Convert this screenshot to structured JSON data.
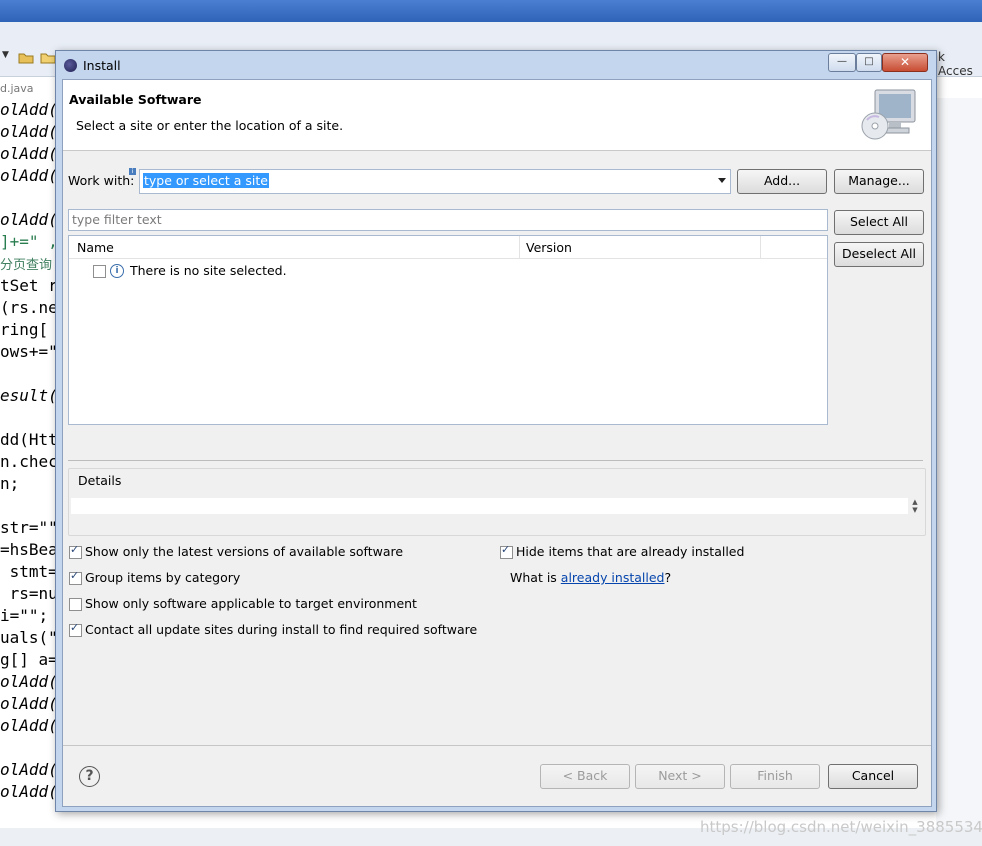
{
  "background": {
    "access_label": "k Acces",
    "tab_label": "d.java",
    "code_lines": [
      {
        "text": "olAdd(",
        "style": "italic"
      },
      {
        "text": "olAdd(",
        "style": "italic"
      },
      {
        "text": "olAdd(",
        "style": "italic"
      },
      {
        "text": "olAdd(",
        "style": "italic"
      },
      {
        "text": "",
        "style": ""
      },
      {
        "text": "olAdd(",
        "style": "italic"
      },
      {
        "text": "]+=\" ,",
        "style": "green"
      },
      {
        "text": "分页查询",
        "style": "cn"
      },
      {
        "text": "tSet r",
        "style": ""
      },
      {
        "text": "(rs.ne",
        "style": ""
      },
      {
        "text": "ring[",
        "style": ""
      },
      {
        "text": "ows+=\"",
        "style": ""
      },
      {
        "text": "",
        "style": ""
      },
      {
        "text": "esult(",
        "style": "italic"
      },
      {
        "text": "",
        "style": ""
      },
      {
        "text": "dd(Htt",
        "style": ""
      },
      {
        "text": "n.chec",
        "style": ""
      },
      {
        "text": "n;",
        "style": ""
      },
      {
        "text": "",
        "style": ""
      },
      {
        "text": "str=\"\"",
        "style": ""
      },
      {
        "text": "=hsBea",
        "style": ""
      },
      {
        "text": " stmt=",
        "style": ""
      },
      {
        "text": " rs=nu",
        "style": ""
      },
      {
        "text": "i=\"\";",
        "style": ""
      },
      {
        "text": "uals(\"",
        "style": ""
      },
      {
        "text": "g[] a=",
        "style": ""
      },
      {
        "text": "olAdd(",
        "style": "italic"
      },
      {
        "text": "olAdd(",
        "style": "italic"
      },
      {
        "text": "olAdd(",
        "style": "italic"
      },
      {
        "text": "",
        "style": ""
      },
      {
        "text": "olAdd(",
        "style": "italic"
      },
      {
        "text": "olAdd(",
        "style": "italic"
      }
    ],
    "watermark": "https://blog.csdn.net/weixin_38855344"
  },
  "dialog": {
    "title": "Install",
    "window_buttons": {
      "minimize": "—",
      "maximize": "□",
      "close": "✕"
    },
    "header": {
      "title": "Available Software",
      "description": "Select a site or enter the location of a site."
    },
    "work_with": {
      "label": "Work with:",
      "value": "type or select a site",
      "add_label": "Add...",
      "manage_label": "Manage..."
    },
    "filter": {
      "placeholder": "type filter text"
    },
    "select_all_label": "Select All",
    "deselect_all_label": "Deselect All",
    "table": {
      "columns": [
        "Name",
        "Version"
      ],
      "rows": [
        {
          "name": "There is no site selected.",
          "version": ""
        }
      ]
    },
    "details": {
      "label": "Details",
      "value": ""
    },
    "options": {
      "latest_versions": {
        "label": "Show only the latest versions of available software",
        "checked": true
      },
      "group_by_category": {
        "label": "Group items by category",
        "checked": true
      },
      "applicable_only": {
        "label": "Show only software applicable to target environment",
        "checked": false
      },
      "contact_all_sites": {
        "label": "Contact all update sites during install to find required software",
        "checked": true
      },
      "hide_installed": {
        "label": "Hide items that are already installed",
        "checked": true
      },
      "what_is_prefix": "What is ",
      "what_is_link": "already installed",
      "what_is_suffix": "?"
    },
    "footer": {
      "help_glyph": "?",
      "back_label": "< Back",
      "next_label": "Next >",
      "finish_label": "Finish",
      "cancel_label": "Cancel"
    }
  }
}
